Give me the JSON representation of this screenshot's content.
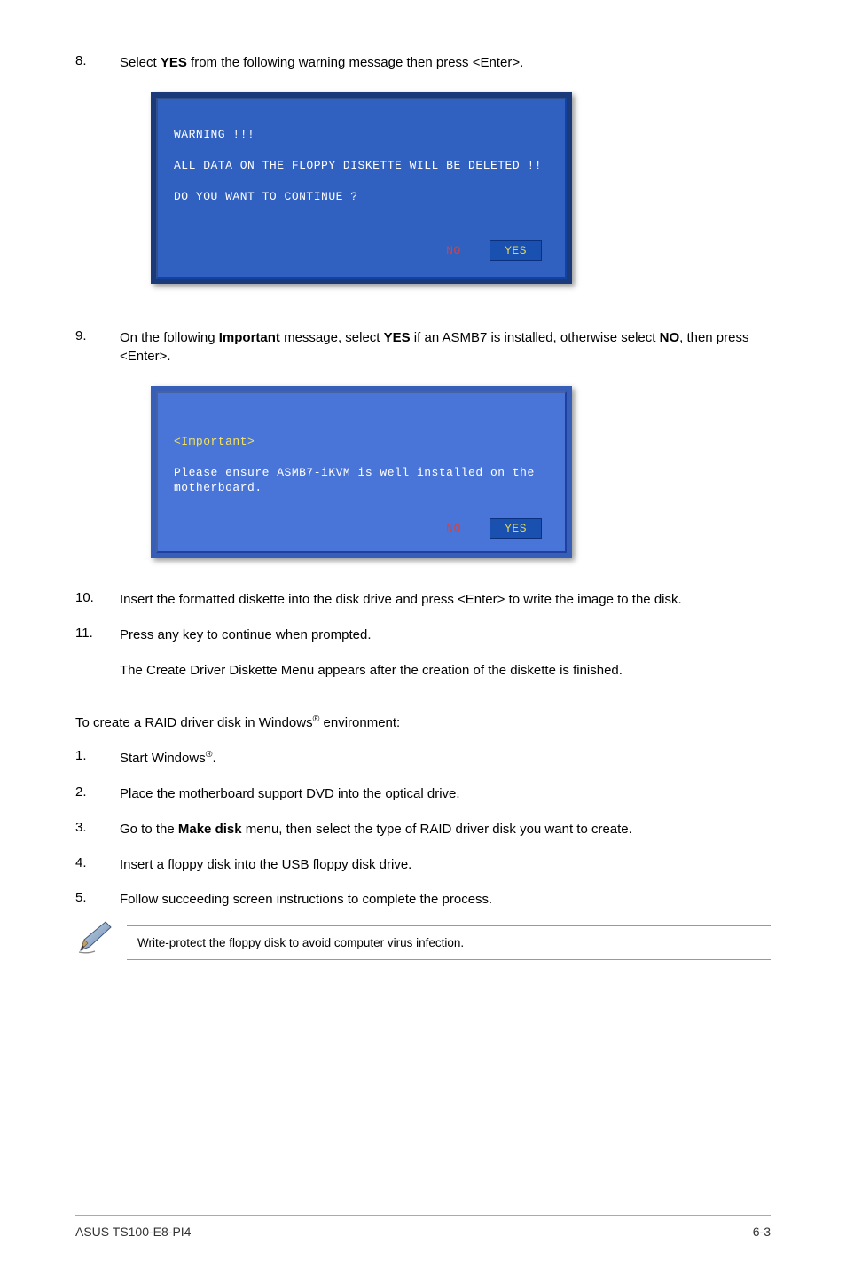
{
  "step8": {
    "num": "8.",
    "text_before": "Select ",
    "text_bold": "YES",
    "text_after": " from the following warning message then press <Enter>."
  },
  "dialog1": {
    "line1": "WARNING !!!",
    "line2": "ALL DATA ON THE FLOPPY DISKETTE WILL BE DELETED !!",
    "line3": "DO YOU WANT TO CONTINUE ?",
    "no_label": "NO",
    "yes_label": "YES"
  },
  "step9": {
    "num": "9.",
    "text_a": "On the following ",
    "bold1": "Important",
    "text_b": " message, select ",
    "bold2": "YES",
    "text_c": " if an ASMB7 is installed, otherwise select ",
    "bold3": "NO",
    "text_d": ", then press <Enter>."
  },
  "dialog2": {
    "line1": "<Important>",
    "line2": "Please ensure ASMB7-iKVM is well installed on the motherboard.",
    "no_label": "NO",
    "yes_label": "YES"
  },
  "step10": {
    "num": "10.",
    "text": "Insert the formatted diskette into the disk drive and press <Enter> to write the image to the disk."
  },
  "step11": {
    "num": "11.",
    "text": "Press any key to continue when prompted."
  },
  "step11_sub": "The Create Driver Diskette Menu appears after the creation of the diskette is finished.",
  "windows_para": {
    "text_a": "To create a RAID driver disk in Windows",
    "reg": "®",
    "text_b": " environment:"
  },
  "w1": {
    "num": "1.",
    "text_a": "Start Windows",
    "reg": "®",
    "text_b": "."
  },
  "w2": {
    "num": "2.",
    "text": "Place the motherboard support DVD into the optical drive."
  },
  "w3": {
    "num": "3.",
    "text_a": "Go to the ",
    "bold": "Make disk",
    "text_b": " menu, then select the type of RAID driver disk you want to create."
  },
  "w4": {
    "num": "4.",
    "text": "Insert a floppy disk into the USB floppy disk drive."
  },
  "w5": {
    "num": "5.",
    "text": "Follow succeeding screen instructions to complete the process."
  },
  "note": "Write-protect the floppy disk to avoid computer virus infection.",
  "footer_left": "ASUS TS100-E8-PI4",
  "footer_right": "6-3"
}
